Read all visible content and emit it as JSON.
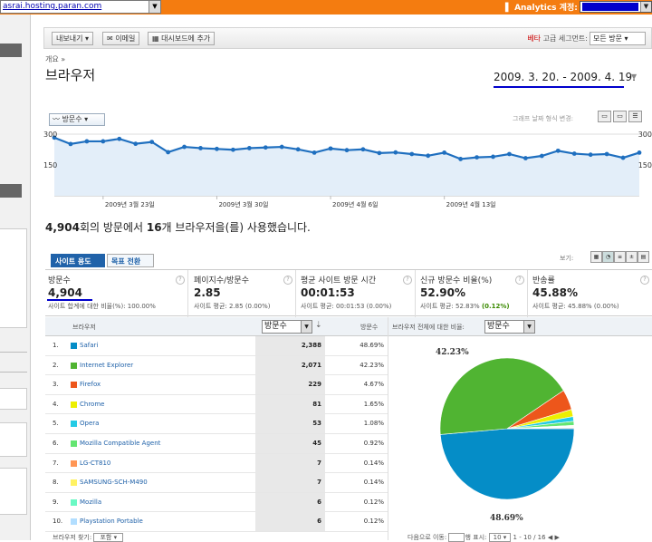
{
  "topbar": {
    "site": "asrai.hosting.paran.com",
    "analytics_label": "Analytics 계정:"
  },
  "toolbar": {
    "export_label": "내보내기",
    "email_label": "이메일",
    "dashboard_label": "대시보드에 추가",
    "beta_label": "베타",
    "advanced_segment_label": "고급 세그먼트:",
    "segment_value": "모든 방문"
  },
  "breadcrumb": "개요 »",
  "page_title": "브라우저",
  "date_range": "2009. 3. 20. - 2009. 4. 19.",
  "chart_controls": {
    "metric_select": "방문수",
    "graph_by": "그래프 날짜 형식 변경:"
  },
  "chart_data": {
    "type": "line",
    "series": [
      {
        "values": [
          283,
          252,
          265,
          265,
          277,
          253,
          262,
          212,
          238,
          232,
          228,
          224,
          232,
          235,
          238,
          226,
          210,
          230,
          222,
          226,
          208,
          211,
          203,
          195,
          210,
          179,
          187,
          190,
          203,
          183,
          194,
          219,
          205,
          200,
          203,
          185,
          210
        ]
      }
    ],
    "ylim": [
      0,
      300
    ],
    "y_ticks": [
      "300",
      "150"
    ],
    "y_ticks_right": [
      "300",
      "150"
    ],
    "x_tick_labels": [
      "2009년 3월 23일",
      "2009년 3월 30일",
      "2009년 4월 6일",
      "2009년 4월 13일"
    ],
    "x_tick_index": [
      3,
      10,
      17,
      24
    ],
    "color": "#1f6fbf",
    "fill": "#e3eef9"
  },
  "summary": {
    "visits": "4,904",
    "text1": "회의 방문에서 ",
    "count": "16",
    "text2": "개 브라우저을(를) 사용했습니다."
  },
  "tabs": {
    "site_usage": "사이트 용도",
    "goal_conversion": "목표 전환"
  },
  "views_label": "보기:",
  "metrics": [
    {
      "label": "방문수",
      "value": "4,904",
      "sub": "사이트 합계에 대한 비율(%): 100.00%"
    },
    {
      "label": "페이지수/방문수",
      "value": "2.85",
      "sub": "사이트 평균: 2.85 (0.00%)"
    },
    {
      "label": "평균 사이트 방문 시간",
      "value": "00:01:53",
      "sub": "사이트 평균: 00:01:53 (0.00%)"
    },
    {
      "label": "신규 방문수 비율(%)",
      "value": "52.90%",
      "sub": "사이트 평균: 52.83%",
      "sub_delta": "(0.12%)"
    },
    {
      "label": "반송률",
      "value": "45.88%",
      "sub": "사이트 평균: 45.88% (0.00%)"
    }
  ],
  "table": {
    "col_browser": "브라우저",
    "col_metric": "방문수",
    "col_pct": "방문수",
    "rows": [
      {
        "num": "1.",
        "name": "Safari",
        "visits": "2,388",
        "pct": "48.69%",
        "color": "#058dc7"
      },
      {
        "num": "2.",
        "name": "Internet Explorer",
        "visits": "2,071",
        "pct": "42.23%",
        "color": "#50b432"
      },
      {
        "num": "3.",
        "name": "Firefox",
        "visits": "229",
        "pct": "4.67%",
        "color": "#ed561b"
      },
      {
        "num": "4.",
        "name": "Chrome",
        "visits": "81",
        "pct": "1.65%",
        "color": "#edef00"
      },
      {
        "num": "5.",
        "name": "Opera",
        "visits": "53",
        "pct": "1.08%",
        "color": "#24cbe5"
      },
      {
        "num": "6.",
        "name": "Mozilla Compatible Agent",
        "visits": "45",
        "pct": "0.92%",
        "color": "#64e572"
      },
      {
        "num": "7.",
        "name": "LG-CT810",
        "visits": "7",
        "pct": "0.14%",
        "color": "#ff9655"
      },
      {
        "num": "8.",
        "name": "SAMSUNG-SCH-M490",
        "visits": "7",
        "pct": "0.14%",
        "color": "#fff263"
      },
      {
        "num": "9.",
        "name": "Mozilla",
        "visits": "6",
        "pct": "0.12%",
        "color": "#6af9c4"
      },
      {
        "num": "10.",
        "name": "Playstation Portable",
        "visits": "6",
        "pct": "0.12%",
        "color": "#b2deff"
      }
    ]
  },
  "pie": {
    "head_label": "브라우저 전체에 대한 비율:",
    "metric_select": "방문수",
    "label_top": "42.23%",
    "label_bottom": "48.69%",
    "slices": [
      48.69,
      42.23,
      4.67,
      1.65,
      1.08,
      0.92,
      0.14,
      0.14,
      0.12,
      0.12,
      0.24
    ],
    "colors": [
      "#058dc7",
      "#50b432",
      "#ed561b",
      "#edef00",
      "#24cbe5",
      "#64e572",
      "#ff9655",
      "#fff263",
      "#6af9c4",
      "#b2deff",
      "#cccccc"
    ]
  },
  "footer": {
    "left": "브라우저 찾기:",
    "left_select": "포함",
    "right": "다음으로 이동:",
    "rows_label": "행 표시:",
    "rows_value": "10",
    "range": "1 - 10 / 16"
  }
}
